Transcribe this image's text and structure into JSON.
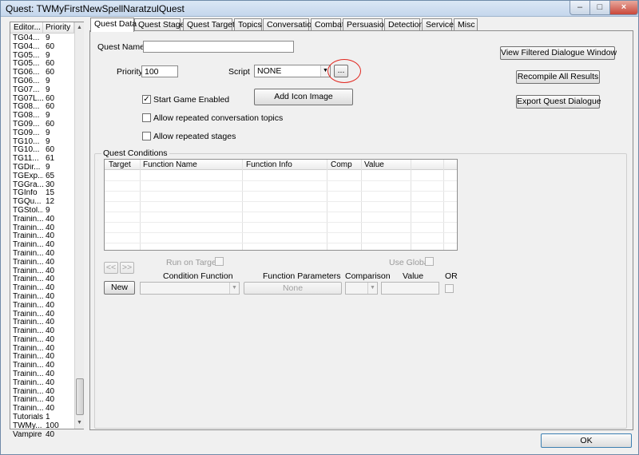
{
  "window": {
    "title": "Quest: TWMyFirstNewSpellNaratzulQuest",
    "controls": {
      "minimize": "–",
      "maximize": "□",
      "close": "×"
    }
  },
  "quest_list": {
    "columns": [
      "Editor...",
      "Priority"
    ],
    "rows": [
      {
        "name": "TG04...",
        "priority": "9"
      },
      {
        "name": "TG04...",
        "priority": "60"
      },
      {
        "name": "TG05...",
        "priority": "9"
      },
      {
        "name": "TG05...",
        "priority": "60"
      },
      {
        "name": "TG06...",
        "priority": "60"
      },
      {
        "name": "TG06...",
        "priority": "9"
      },
      {
        "name": "TG07...",
        "priority": "9"
      },
      {
        "name": "TG07L...",
        "priority": "60"
      },
      {
        "name": "TG08...",
        "priority": "60"
      },
      {
        "name": "TG08...",
        "priority": "9"
      },
      {
        "name": "TG09...",
        "priority": "60"
      },
      {
        "name": "TG09...",
        "priority": "9"
      },
      {
        "name": "TG10...",
        "priority": "9"
      },
      {
        "name": "TG10...",
        "priority": "60"
      },
      {
        "name": "TG11...",
        "priority": "61"
      },
      {
        "name": "TGDir...",
        "priority": "9"
      },
      {
        "name": "TGExp...",
        "priority": "65"
      },
      {
        "name": "TGGra...",
        "priority": "30"
      },
      {
        "name": "TGInfo",
        "priority": "15"
      },
      {
        "name": "TGQu...",
        "priority": "12"
      },
      {
        "name": "TGStol...",
        "priority": "9"
      },
      {
        "name": "Trainin...",
        "priority": "40"
      },
      {
        "name": "Trainin...",
        "priority": "40"
      },
      {
        "name": "Trainin...",
        "priority": "40"
      },
      {
        "name": "Trainin...",
        "priority": "40"
      },
      {
        "name": "Trainin...",
        "priority": "40"
      },
      {
        "name": "Trainin...",
        "priority": "40"
      },
      {
        "name": "Trainin...",
        "priority": "40"
      },
      {
        "name": "Trainin...",
        "priority": "40"
      },
      {
        "name": "Trainin...",
        "priority": "40"
      },
      {
        "name": "Trainin...",
        "priority": "40"
      },
      {
        "name": "Trainin...",
        "priority": "40"
      },
      {
        "name": "Trainin...",
        "priority": "40"
      },
      {
        "name": "Trainin...",
        "priority": "40"
      },
      {
        "name": "Trainin...",
        "priority": "40"
      },
      {
        "name": "Trainin...",
        "priority": "40"
      },
      {
        "name": "Trainin...",
        "priority": "40"
      },
      {
        "name": "Trainin...",
        "priority": "40"
      },
      {
        "name": "Trainin...",
        "priority": "40"
      },
      {
        "name": "Trainin...",
        "priority": "40"
      },
      {
        "name": "Trainin...",
        "priority": "40"
      },
      {
        "name": "Trainin...",
        "priority": "40"
      },
      {
        "name": "Trainin...",
        "priority": "40"
      },
      {
        "name": "Trainin...",
        "priority": "40"
      },
      {
        "name": "Tutorials",
        "priority": "1"
      },
      {
        "name": "TWMy...",
        "priority": "100"
      },
      {
        "name": "Vampire",
        "priority": "40"
      }
    ]
  },
  "tabs": [
    "Quest Data",
    "Quest Stages",
    "Quest Targets",
    "Topics",
    "Conversation",
    "Combat",
    "Persuasion",
    "Detection",
    "Service",
    "Misc"
  ],
  "quest_data": {
    "quest_name_label": "Quest Name",
    "quest_name_value": "",
    "priority_label": "Priority",
    "priority_value": "100",
    "script_label": "Script",
    "script_value": "NONE",
    "script_browse": "...",
    "start_game_enabled": "Start Game Enabled",
    "allow_repeated_topics": "Allow repeated conversation topics",
    "allow_repeated_stages": "Allow repeated stages",
    "add_icon_image": "Add Icon Image",
    "view_filtered_dialogue": "View Filtered Dialogue Window",
    "recompile_all": "Recompile All Results",
    "export_dialogue": "Export Quest Dialogue"
  },
  "conditions": {
    "title": "Quest Conditions",
    "columns": [
      "Target",
      "Function Name",
      "Function Info",
      "Comp",
      "Value"
    ],
    "prev": "<<",
    "next": ">>",
    "run_on_target": "Run on Target",
    "use_global": "Use Global",
    "new_button": "New",
    "condition_function": "Condition Function",
    "function_parameters": "Function Parameters",
    "function_params_button": "None",
    "comparison": "Comparison",
    "value": "Value",
    "or": "OR"
  },
  "footer": {
    "ok": "OK"
  }
}
